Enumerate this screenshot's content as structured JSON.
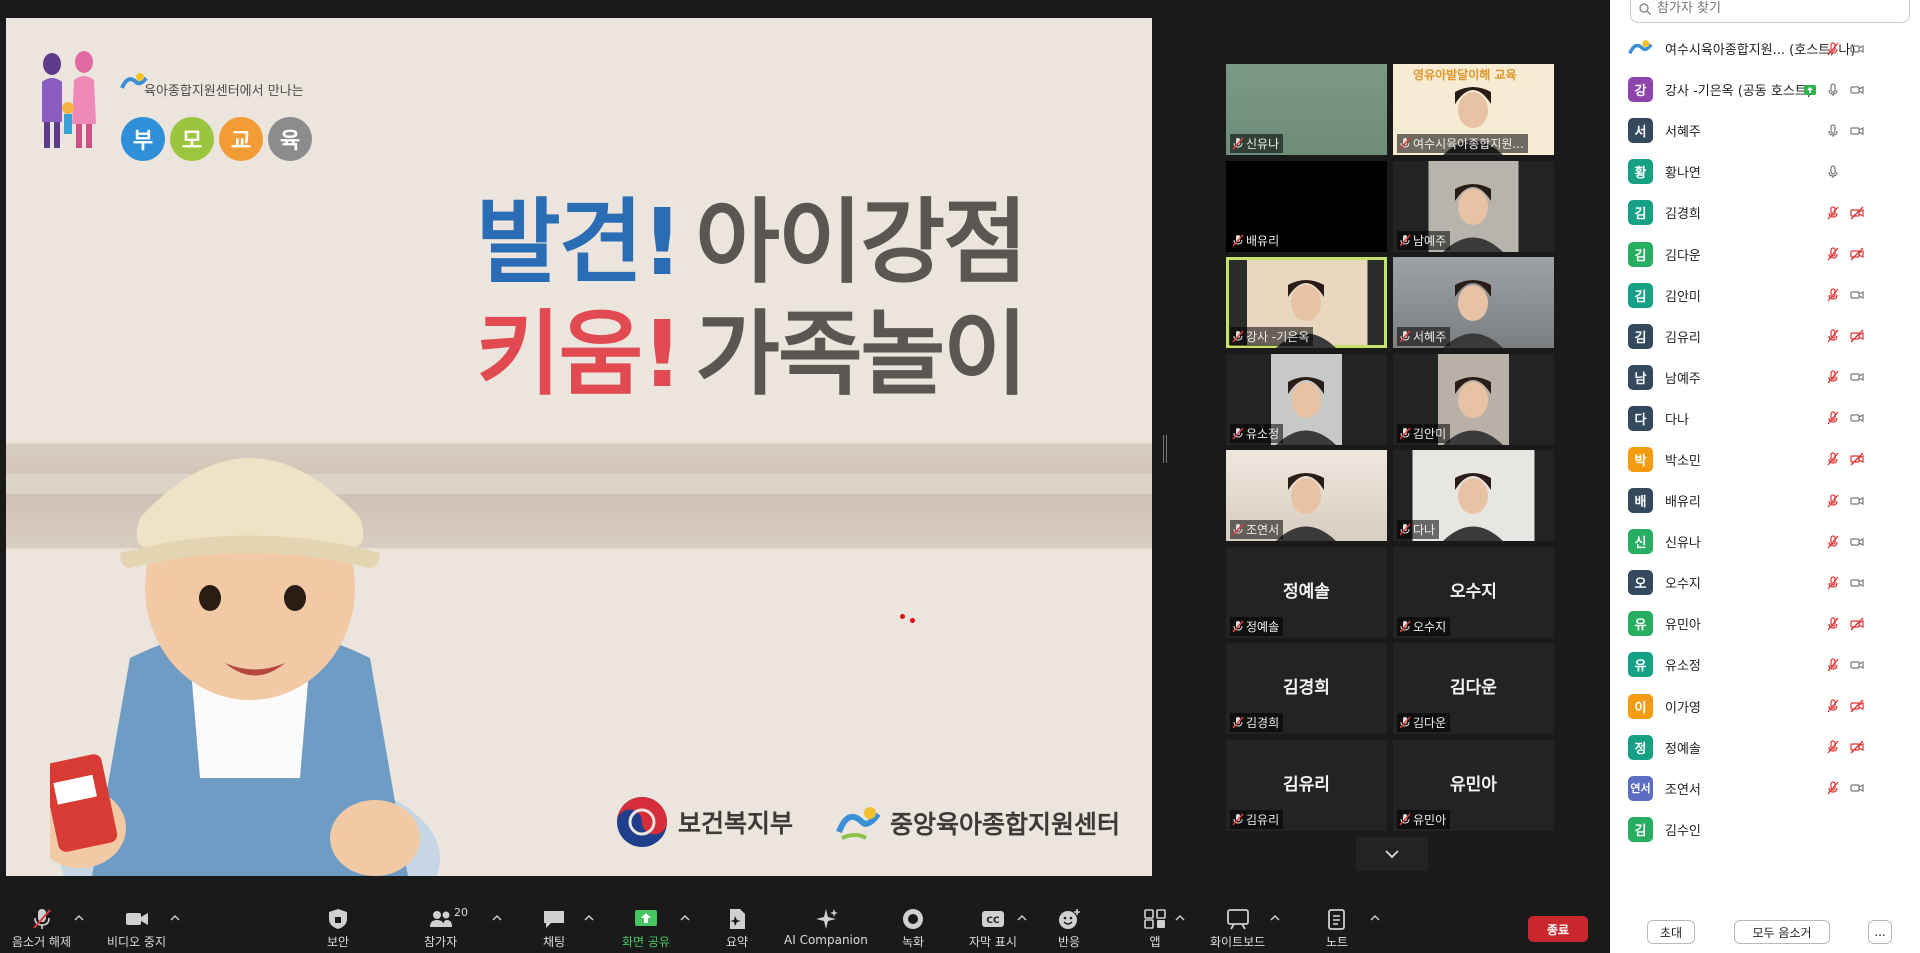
{
  "slide": {
    "brand_sub": "육아종합지원센터에서 만나는",
    "brand_chips": [
      "부",
      "모",
      "교",
      "육"
    ],
    "title_line1_accent": "발견!",
    "title_line1_rest": "아이강점",
    "title_line2_accent": "키움!",
    "title_line2_rest": "가족놀이",
    "ministry": "보건복지부",
    "center": "중앙육아종합지원센터"
  },
  "gallery": {
    "tiles": [
      {
        "name": "신유나"
      },
      {
        "name": "여수시육아종합지원..."
      },
      {
        "name": "배유리"
      },
      {
        "name": "남예주"
      },
      {
        "name": "강사 -기은옥"
      },
      {
        "name": "서혜주"
      },
      {
        "name": "유소정"
      },
      {
        "name": "김안미"
      },
      {
        "name": "조연서"
      },
      {
        "name": "다나"
      },
      {
        "name": "정예솔",
        "big": "정예솔"
      },
      {
        "name": "오수지",
        "big": "오수지"
      },
      {
        "name": "김경희",
        "big": "김경희"
      },
      {
        "name": "김다운",
        "big": "김다운"
      },
      {
        "name": "김유리",
        "big": "김유리"
      },
      {
        "name": "유민아",
        "big": "유민아"
      }
    ],
    "poster_text": "영유아발달이해 교육"
  },
  "panel": {
    "search_placeholder": "참가자 찾기",
    "participants": [
      {
        "avatar": "",
        "name": "여수시육아종합지원... (호스트, 나)",
        "color": "#ffffff"
      },
      {
        "avatar": "강",
        "name": "강사 -기은옥 (공동 호스트)",
        "color": "#8e44ad"
      },
      {
        "avatar": "서",
        "name": "서혜주",
        "color": "#34495e"
      },
      {
        "avatar": "황",
        "name": "황나연",
        "color": "#16a085"
      },
      {
        "avatar": "김",
        "name": "김경희",
        "color": "#16a085"
      },
      {
        "avatar": "김",
        "name": "김다운",
        "color": "#27ae60"
      },
      {
        "avatar": "김",
        "name": "김안미",
        "color": "#16a085"
      },
      {
        "avatar": "김",
        "name": "김유리",
        "color": "#34495e"
      },
      {
        "avatar": "남",
        "name": "남예주",
        "color": "#34495e"
      },
      {
        "avatar": "다",
        "name": "다나",
        "color": "#34495e"
      },
      {
        "avatar": "박",
        "name": "박소민",
        "color": "#f39c12"
      },
      {
        "avatar": "배",
        "name": "배유리",
        "color": "#34495e"
      },
      {
        "avatar": "신",
        "name": "신유나",
        "color": "#27ae60"
      },
      {
        "avatar": "오",
        "name": "오수지",
        "color": "#34495e"
      },
      {
        "avatar": "유",
        "name": "유민아",
        "color": "#27ae60"
      },
      {
        "avatar": "유",
        "name": "유소정",
        "color": "#16a085"
      },
      {
        "avatar": "이",
        "name": "이가영",
        "color": "#f39c12"
      },
      {
        "avatar": "정",
        "name": "정예솔",
        "color": "#16a085"
      },
      {
        "avatar": "연서",
        "name": "조연서",
        "color": "#5b6ec2"
      },
      {
        "avatar": "김",
        "name": "김수인",
        "color": "#27ae60"
      }
    ],
    "invite_label": "초대",
    "mute_all_label": "모두 음소거",
    "more_label": "..."
  },
  "toolbar": {
    "unmute": "음소거 해제",
    "stop_video": "비디오 중지",
    "security": "보안",
    "participants": "참가자",
    "participants_count": "20",
    "chat": "채팅",
    "share": "화면 공유",
    "summary": "요약",
    "ai": "AI Companion",
    "record": "녹화",
    "captions": "자막 표시",
    "reactions": "반응",
    "apps": "앱",
    "whiteboard": "화이트보드",
    "notes": "노트",
    "end": "종료"
  },
  "colors": {
    "accent_blue": "#2b6db5",
    "accent_red": "#e24a52",
    "active_speaker": "#c6e26b",
    "end_red": "#c9272d",
    "share_green": "#46c660"
  }
}
